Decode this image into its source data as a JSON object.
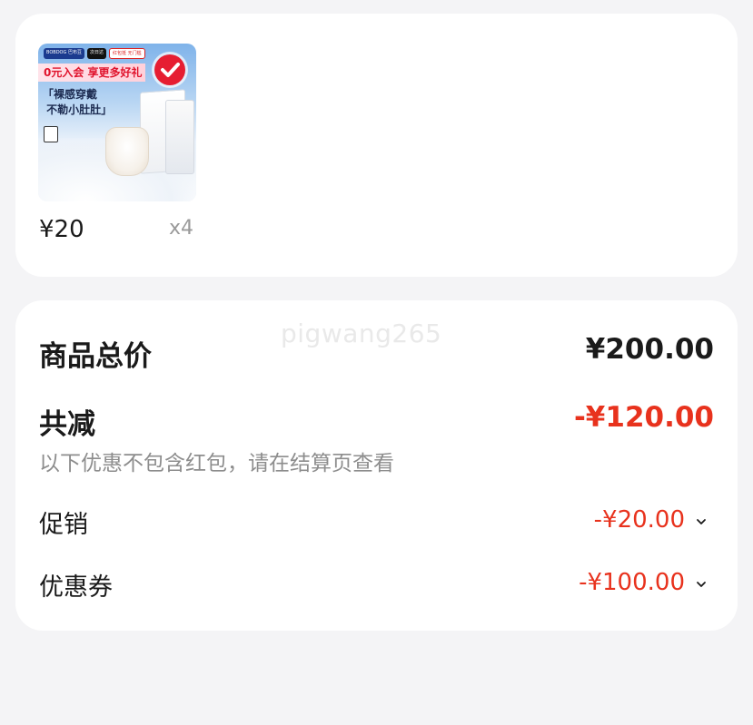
{
  "product": {
    "thumbnail": {
      "tags": [
        "BOBDOG 巴布豆",
        "次日达",
        "红包抵 无门槛"
      ],
      "banner": "0元入会 享更多好礼",
      "slogan": "「裸感穿戴\n 不勒小肚肚」"
    },
    "price": "¥20",
    "quantity": "x4"
  },
  "summary": {
    "watermark": "pigwang265",
    "total_label": "商品总价",
    "total_value": "¥200.00",
    "discount_label": "共减",
    "discount_value": "-¥120.00",
    "discount_note": "以下优惠不包含红包，请在结算页查看",
    "promo_label": "促销",
    "promo_value": "-¥20.00",
    "coupon_label": "优惠券",
    "coupon_value": "-¥100.00"
  },
  "colors": {
    "background": "#f4f4f6",
    "card": "#ffffff",
    "discount_red": "#e8321d",
    "muted_text": "#8d8d8d"
  },
  "icons": {
    "promo_expand": "chevron-down-icon",
    "coupon_expand": "chevron-down-icon",
    "thumbnail_check": "check-circle-icon"
  }
}
